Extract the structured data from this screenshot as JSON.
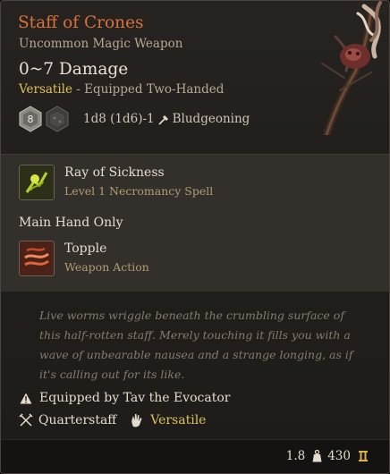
{
  "item": {
    "name": "Staff of Crones",
    "rarity_type": "Uncommon Magic Weapon",
    "damage": "0~7 Damage",
    "property": "Versatile",
    "equip_status": " - Equipped Two-Handed",
    "die_value": "8",
    "dice_text": "1d8 (1d6)-1",
    "damage_type": "Bludgeoning",
    "colors": {
      "title": "#d8713c",
      "versatile": "#dcc25c",
      "subtext": "#b09c73"
    }
  },
  "actions": [
    {
      "name": "Ray of Sickness",
      "sub": "Level 1 Necromancy Spell",
      "icon": "ray-of-sickness-icon"
    },
    {
      "name": "Topple",
      "sub": "Weapon Action",
      "icon": "topple-icon"
    }
  ],
  "main_hand_label": "Main Hand Only",
  "description": "Live worms wriggle beneath the crumbling surface of this half-rotten staff. Merely touching it fills you with a wave of unbearable nausea and a strange longing, as if it's calling out for its like.",
  "equipped_by": "Equipped by Tav the Evocator",
  "proficiency": "Quarterstaff",
  "versatile_label": "Versatile",
  "footer": {
    "weight": "1.8",
    "value": "430"
  }
}
